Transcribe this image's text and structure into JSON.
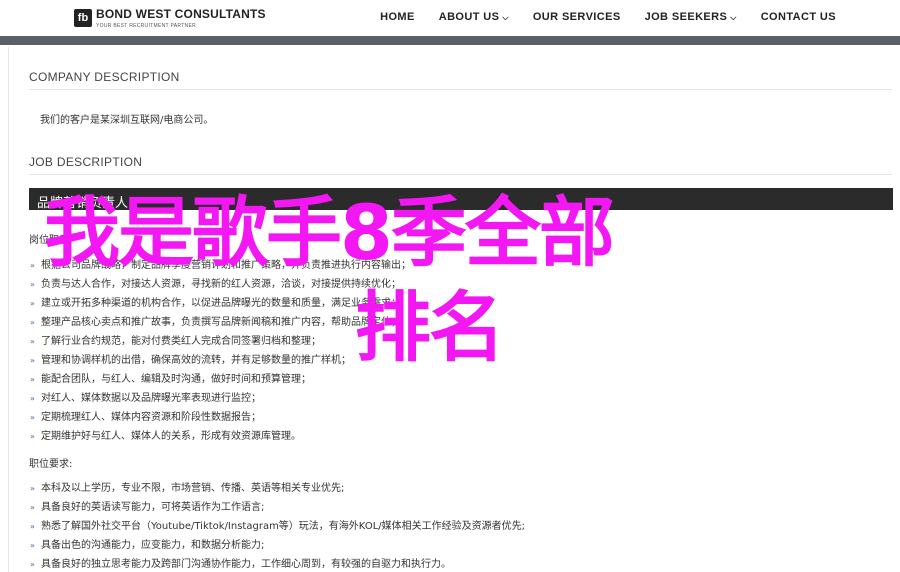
{
  "brand": {
    "mark": "fb",
    "name": "BOND WEST CONSULTANTS",
    "tagline": "YOUR BEST RECRUITMENT PARTNER"
  },
  "nav": {
    "items": [
      {
        "label": "HOME"
      },
      {
        "label": "ABOUT US",
        "dropdown": true
      },
      {
        "label": "OUR SERVICES"
      },
      {
        "label": "JOB SEEKERS",
        "dropdown": true
      },
      {
        "label": "CONTACT US"
      }
    ]
  },
  "company": {
    "title": "COMPANY DESCRIPTION",
    "text": "我们的客户是某深圳互联网/电商公司。"
  },
  "job": {
    "title": "JOB DESCRIPTION",
    "position": "品牌营销负责人",
    "duties_heading": "岗位职责:",
    "duties": [
      "根据公司品牌战略，制定品牌季度营销计划和推广策略，并负责推进执行内容输出；",
      "负责与达人合作，对接达人资源，寻找新的红人资源，洽谈，对接提供持续优化；",
      "建立或开拓多种渠道的机构合作，以促进品牌曝光的数量和质量，满足业务需求；",
      "整理产品核心卖点和推广故事，负责撰写品牌新闻稿和推广内容，帮助品牌定位；",
      "了解行业合约规范，能对付费类红人完成合同签署归档和整理；",
      "管理和协调样机的出借，确保高效的流转，并有足够数量的推广样机；",
      "能配合团队，与红人、编辑及时沟通，做好时间和预算管理；",
      "对红人、媒体数据以及品牌曝光率表现进行监控；",
      "定期梳理红人、媒体内容资源和阶段性数据报告；",
      "定期维护好与红人、媒体人的关系，形成有效资源库管理。"
    ],
    "requirements_heading": "职位要求:",
    "requirements": [
      "本科及以上学历，专业不限，市场营销、传播、英语等相关专业优先;",
      "具备良好的英语读写能力，可将英语作为工作语言;",
      "熟悉了解国外社交平台（Youtube/Tiktok/Instagram等）玩法，有海外KOL/媒体相关工作经验及资源者优先;",
      "具备出色的沟通能力，应变能力，和数据分析能力;",
      "具备良好的独立思考能力及跨部门沟通协作能力，工作细心周到，有较强的自驱力和执行力。"
    ]
  },
  "overlay": {
    "line1": "我是歌手8季全部",
    "line2": "排名"
  },
  "colors": {
    "overlay": "#f317f3",
    "bullet": "#3a6fb0",
    "header_bar": "#2b2b2b"
  }
}
